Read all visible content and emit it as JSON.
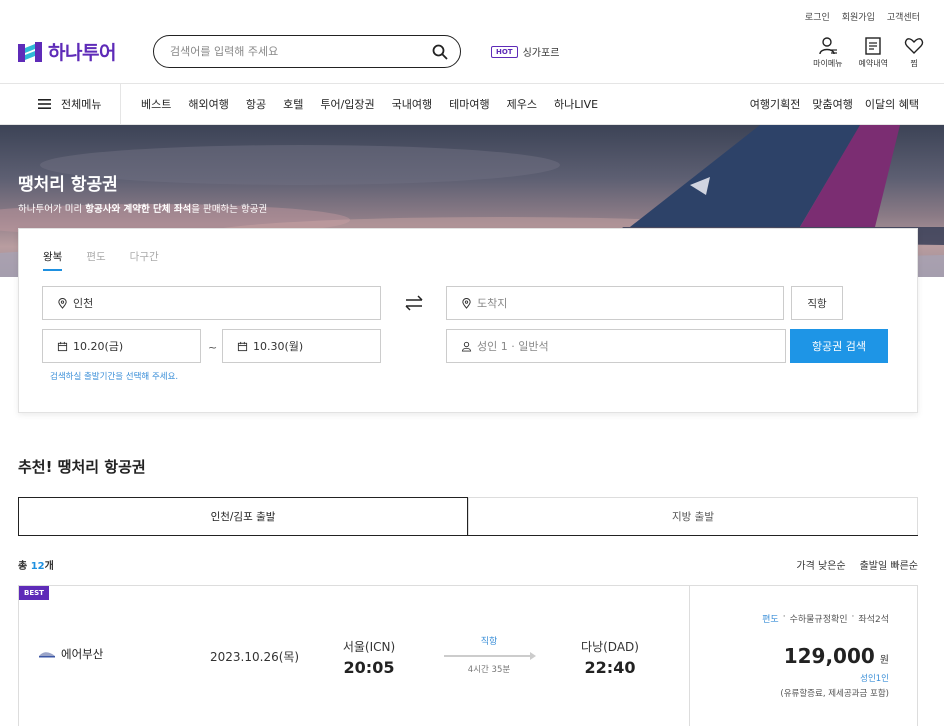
{
  "util_links": [
    "로그인",
    "회원가입",
    "고객센터"
  ],
  "brand": {
    "name": "하나투어",
    "color": "#5e2bb8"
  },
  "search": {
    "placeholder": "검색어를 입력해 주세요",
    "icon": "search-icon"
  },
  "hot": {
    "badge": "HOT",
    "keyword": "싱가포르"
  },
  "header_icons": [
    {
      "label": "마이메뉴",
      "icon": "user-icon"
    },
    {
      "label": "예약내역",
      "icon": "document-icon"
    },
    {
      "label": "찜",
      "icon": "heart-icon"
    }
  ],
  "nav": {
    "all_menu": "전체메뉴",
    "items": [
      "베스트",
      "해외여행",
      "항공",
      "호텔",
      "투어/입장권",
      "국내여행",
      "테마여행",
      "제우스",
      "하나LIVE"
    ],
    "right": [
      "여행기획전",
      "맞춤여행",
      "이달의 혜택"
    ]
  },
  "hero": {
    "title": "땡처리 항공권",
    "sub_pre": "하나투어가 미리 ",
    "sub_bold": "항공사와 계약한 단체 좌석",
    "sub_post": "을 판매하는 항공권"
  },
  "panel": {
    "tabs": [
      "왕복",
      "편도",
      "다구간"
    ],
    "origin": "인천",
    "destination_placeholder": "도착지",
    "depart_date": "10.20(금)",
    "return_date": "10.30(월)",
    "tilde": "~",
    "passengers": "성인 1 · 일반석",
    "direct_button": "직항",
    "search_button": "항공권 검색",
    "hint": "검색하실 출발기간을 선택해 주세요.",
    "accent": "#1e95e6"
  },
  "section": {
    "title": "추천! 땡처리 항공권",
    "tabs": [
      "인천/김포 출발",
      "지방 출발"
    ],
    "count_label": "총 ",
    "count_value": "12",
    "count_unit": "개",
    "sort": [
      "가격 낮은순",
      "출발일 빠른순"
    ]
  },
  "card": {
    "badge": "BEST",
    "airline": "에어부산",
    "date": "2023.10.26(목)",
    "dep_city": "서울(ICN)",
    "dep_time": "20:05",
    "route_type": "직항",
    "duration": "4시간 35분",
    "arr_city": "다낭(DAD)",
    "arr_time": "22:40",
    "info_trip": "편도",
    "info_baggage": "수하물규정확인",
    "info_seats": "좌석2석",
    "price": "129,000",
    "price_unit": "원",
    "adult": "성인1인",
    "included": "(유류할증료, 제세공과금 포함)"
  }
}
